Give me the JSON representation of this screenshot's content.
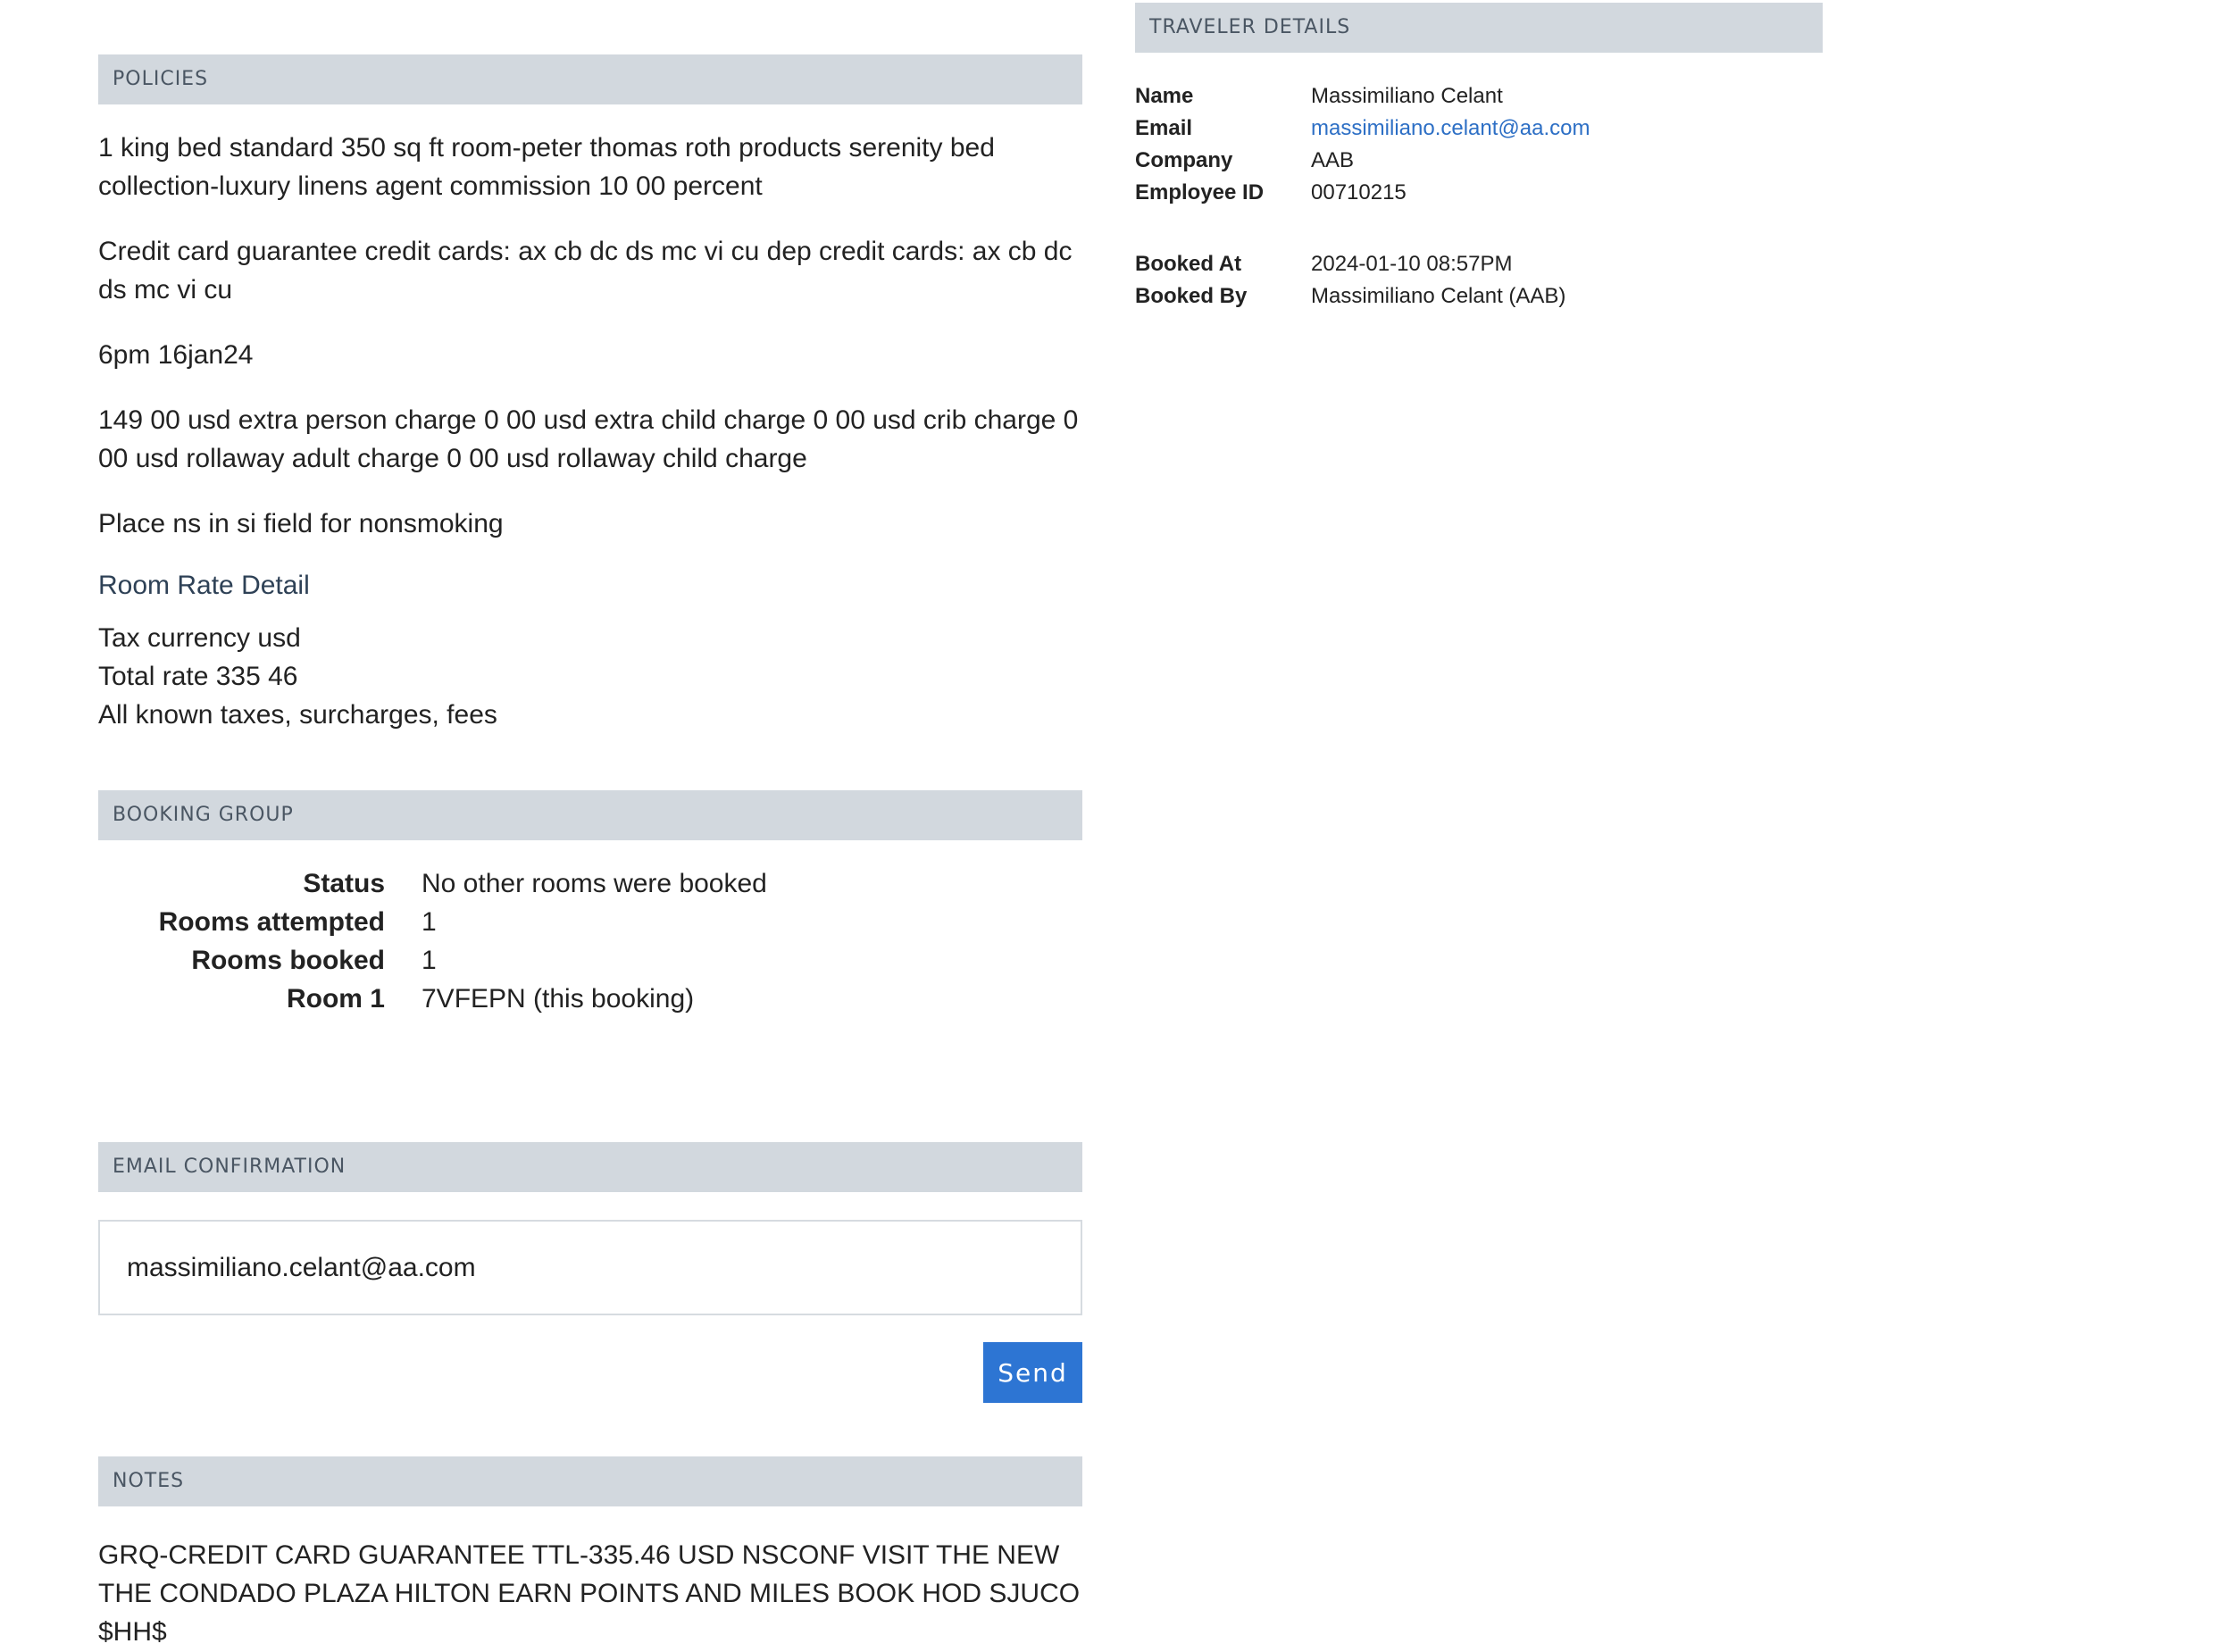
{
  "policies": {
    "header": "POLICIES",
    "paragraphs": [
      "1 king bed standard 350 sq ft room-peter thomas roth products serenity bed collection-luxury linens agent commission 10 00 percent",
      "Credit card guarantee credit cards: ax cb dc ds mc vi cu dep credit cards: ax cb dc ds mc vi cu",
      "6pm 16jan24",
      "149 00 usd extra person charge 0 00 usd extra child charge 0 00 usd crib charge 0 00 usd rollaway adult charge 0 00 usd rollaway child charge",
      "Place ns in si field for nonsmoking"
    ],
    "room_rate_heading": "Room Rate Detail",
    "rate_lines": [
      "Tax currency usd",
      "Total rate 335 46",
      "All known taxes, surcharges, fees"
    ]
  },
  "booking_group": {
    "header": "BOOKING GROUP",
    "rows": [
      {
        "label": "Status",
        "value": "No other rooms were booked"
      },
      {
        "label": "Rooms attempted",
        "value": "1"
      },
      {
        "label": "Rooms booked",
        "value": "1"
      },
      {
        "label": "Room 1",
        "value": "7VFEPN (this booking)"
      }
    ]
  },
  "email_confirmation": {
    "header": "EMAIL CONFIRMATION",
    "input_value": "massimiliano.celant@aa.com",
    "send_label": "Send"
  },
  "notes": {
    "header": "NOTES",
    "text": "GRQ-CREDIT CARD GUARANTEE TTL-335.46 USD NSCONF VISIT THE NEW THE CONDADO PLAZA HILTON EARN POINTS AND MILES BOOK HOD SJUCO $HH$"
  },
  "traveler_details": {
    "header": "TRAVELER DETAILS",
    "name_label": "Name",
    "name_value": "Massimiliano Celant",
    "email_label": "Email",
    "email_value": "massimiliano.celant@aa.com",
    "company_label": "Company",
    "company_value": "AAB",
    "employee_id_label": "Employee ID",
    "employee_id_value": "00710215",
    "booked_at_label": "Booked At",
    "booked_at_value": "2024-01-10 08:57PM",
    "booked_by_label": "Booked By",
    "booked_by_value": "Massimiliano Celant (AAB)"
  },
  "colors": {
    "section_header_bg": "#d2d8de",
    "send_button_bg": "#2d75d3",
    "link": "#2d6fc5",
    "subheading": "#2e4156"
  }
}
